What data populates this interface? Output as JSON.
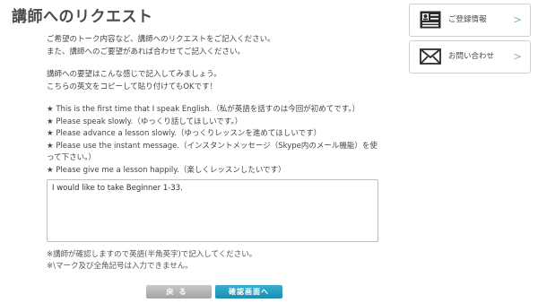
{
  "page": {
    "title": "講師へのリクエスト"
  },
  "intro": {
    "line1": "ご希望のトーク内容など、講師へのリクエストをご記入ください。",
    "line2": "また、講師へのご要望があれば合わせてご記入ください。"
  },
  "example": {
    "line1": "講師への要望はこんな感じで記入してみましょう。",
    "line2": "こちらの英文をコピーして貼り付けてもOKです！"
  },
  "phrases": [
    "★ This is the first time that I speak English.（私が英語を話すのは今回が初めてです。）",
    "★ Please speak slowly.（ゆっくり話してほしいです。）",
    "★ Please advance a lesson slowly.（ゆっくりレッスンを進めてほしいです）",
    "★ Please use the instant message.（インスタントメッセージ（Skype内のメール機能）を使",
    "って下さい。）",
    "★ Please give me a lesson happily.（楽しくレッスンしたいです）"
  ],
  "request_field": {
    "value": "I would like to take Beginner 1-33."
  },
  "notes": {
    "line1": "※講師が確認しますので英語(半角英字)で記入してください。",
    "line2": "※\\マーク及び全角記号は入力できません。"
  },
  "buttons": {
    "back": "戻る",
    "confirm": "確認画面へ"
  },
  "sidebar": {
    "registration": {
      "label": "ご登録情報",
      "icon": "profile-card-icon",
      "chevron": ">"
    },
    "contact": {
      "label": "お問い合わせ",
      "icon": "envelope-icon",
      "chevron": ">"
    }
  }
}
